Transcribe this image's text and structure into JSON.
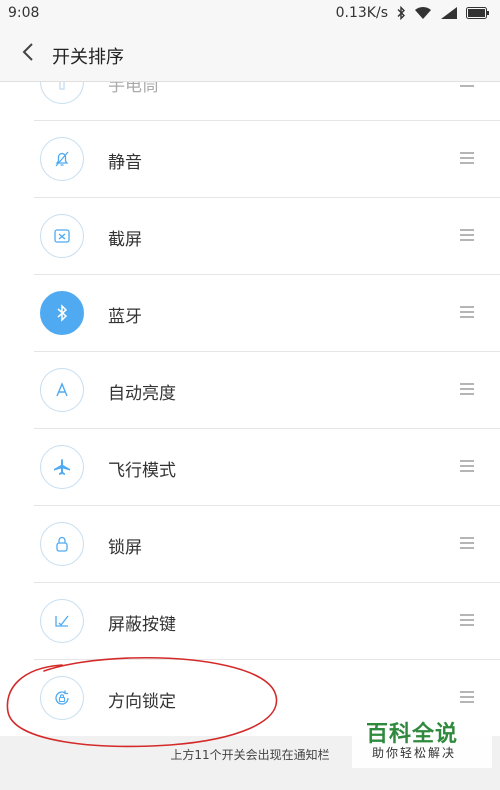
{
  "status": {
    "time": "9:08",
    "net_speed": "0.13K/s"
  },
  "header": {
    "title": "开关排序",
    "back_icon": "chevron-left-icon"
  },
  "items": [
    {
      "label": "手电筒",
      "icon": "flashlight-icon",
      "active": false
    },
    {
      "label": "静音",
      "icon": "bell-mute-icon",
      "active": false
    },
    {
      "label": "截屏",
      "icon": "screenshot-icon",
      "active": false
    },
    {
      "label": "蓝牙",
      "icon": "bluetooth-icon",
      "active": true
    },
    {
      "label": "自动亮度",
      "icon": "auto-brightness-icon",
      "active": false
    },
    {
      "label": "飞行模式",
      "icon": "airplane-icon",
      "active": false
    },
    {
      "label": "锁屏",
      "icon": "lock-icon",
      "active": false
    },
    {
      "label": "屏蔽按键",
      "icon": "block-keys-icon",
      "active": false
    },
    {
      "label": "方向锁定",
      "icon": "rotation-lock-icon",
      "active": false
    }
  ],
  "footer": {
    "text": "上方11个开关会出现在通知栏"
  },
  "watermark": {
    "title": "百科全说",
    "subtitle": "助你轻松解决"
  },
  "colors": {
    "accent": "#4faaf2",
    "annotation": "#d42a2a"
  }
}
